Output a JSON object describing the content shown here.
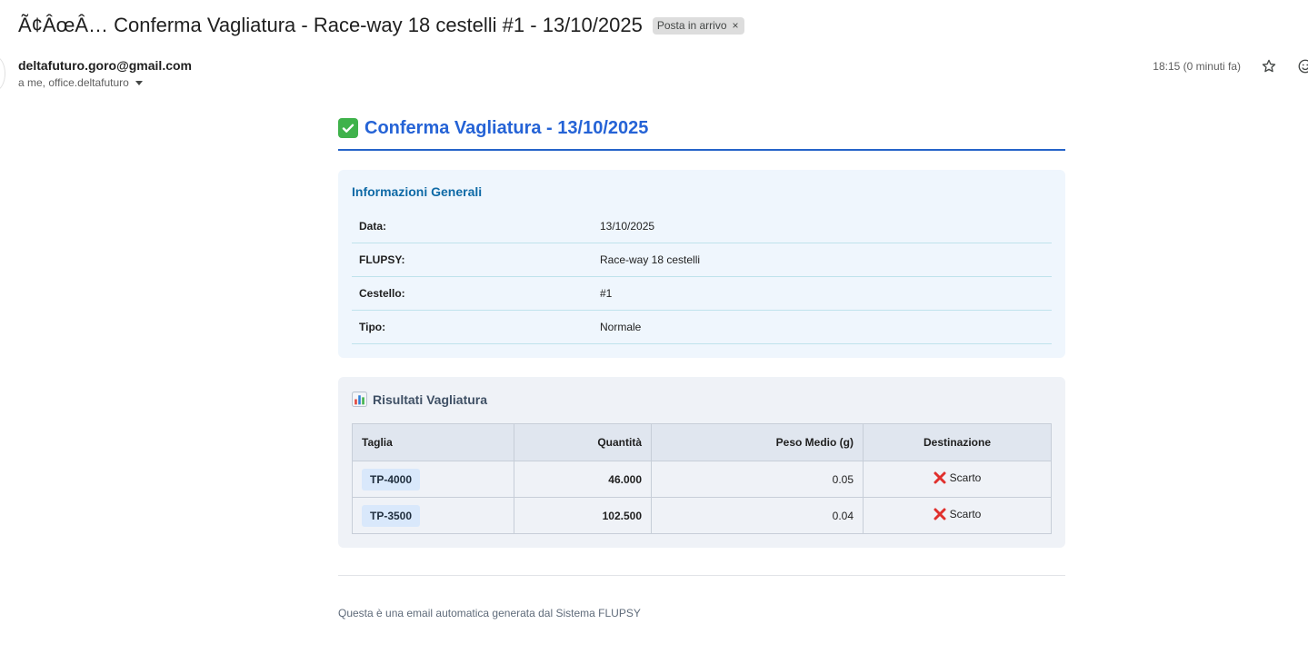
{
  "email": {
    "subject": "Ã¢ÂœÂ… Conferma Vagliatura - Race-way 18 cestelli #1 - 13/10/2025",
    "label": "Posta in arrivo",
    "label_close": "×",
    "sender": "deltafuturo.goro@gmail.com",
    "recipients": "a me, office.deltafuturo",
    "timestamp": "18:15 (0 minuti fa)"
  },
  "body": {
    "title": "Conferma Vagliatura - 13/10/2025",
    "info": {
      "heading": "Informazioni Generali",
      "rows": [
        {
          "key": "Data:",
          "value": "13/10/2025"
        },
        {
          "key": "FLUPSY:",
          "value": "Race-way 18 cestelli"
        },
        {
          "key": "Cestello:",
          "value": "#1"
        },
        {
          "key": "Tipo:",
          "value": "Normale"
        }
      ]
    },
    "results": {
      "heading": "Risultati Vagliatura",
      "columns": [
        "Taglia",
        "Quantità",
        "Peso Medio (g)",
        "Destinazione"
      ],
      "rows": [
        {
          "size": "TP-4000",
          "quantity": "46.000",
          "weight": "0.05",
          "destination": "Scarto"
        },
        {
          "size": "TP-3500",
          "quantity": "102.500",
          "weight": "0.04",
          "destination": "Scarto"
        }
      ]
    },
    "footer": "Questa è una email automatica generata dal Sistema FLUPSY"
  },
  "icons": {
    "check": "check-mark-button-icon",
    "chart": "bar-chart-icon",
    "cross": "cross-mark-icon",
    "star": "star-icon",
    "emoji": "emoji-reaction-icon"
  },
  "colors": {
    "title_blue": "#2563d6",
    "info_heading": "#0f6aa6",
    "info_bg": "#eff6fd",
    "results_bg": "#eff2f7",
    "check_green": "#3fb24b",
    "cross_red": "#e0302d"
  }
}
